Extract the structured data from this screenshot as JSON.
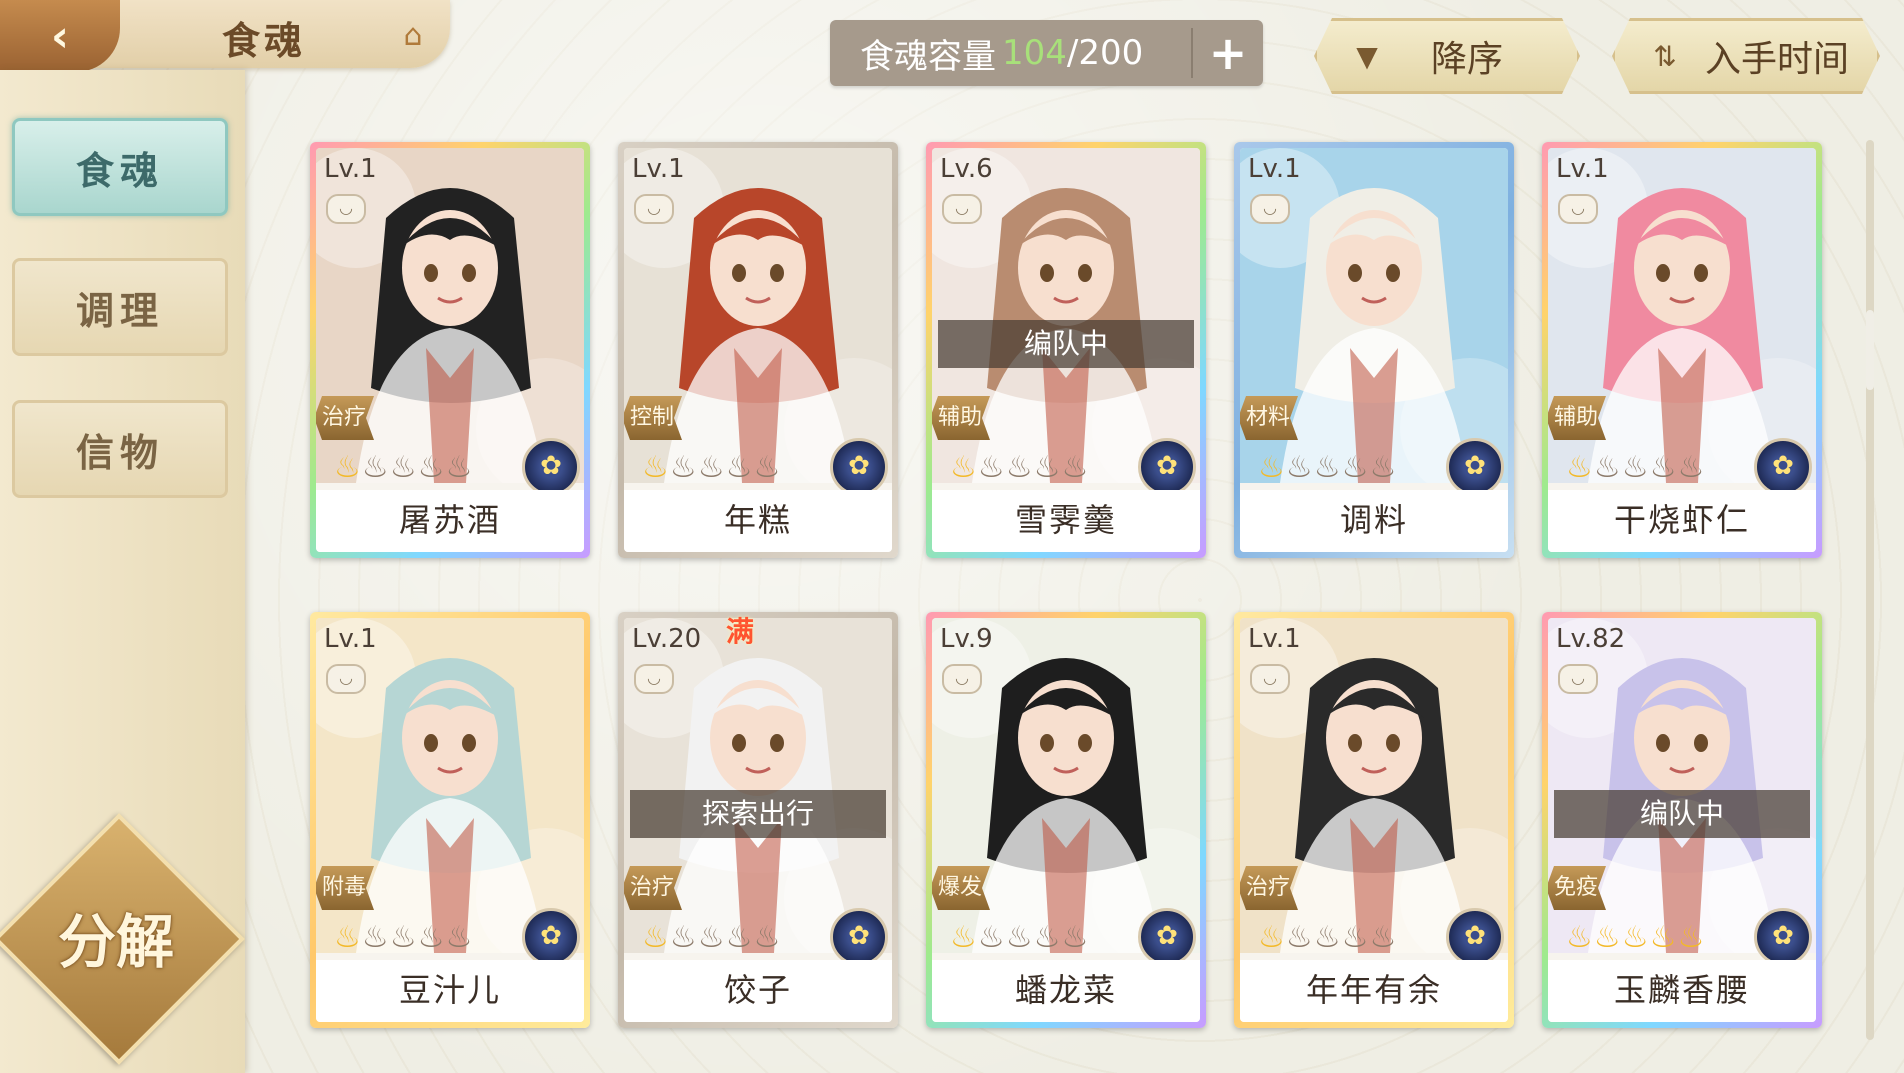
{
  "header": {
    "back_icon": "chevron-left-icon",
    "title": "食魂",
    "house_icon": "house-icon",
    "capacity": {
      "label": "食魂容量",
      "current": "104",
      "max": "/200",
      "add": "+"
    },
    "sort_order": {
      "icon": "triangle-down-icon",
      "label": "降序"
    },
    "sort_by": {
      "icon": "swap-icon",
      "label": "入手时间"
    }
  },
  "sidebar": {
    "items": [
      {
        "label": "食魂",
        "active": true
      },
      {
        "label": "调理",
        "active": false
      },
      {
        "label": "信物",
        "active": false
      }
    ],
    "decompose_label": "分解"
  },
  "cards": [
    {
      "level": "Lv.1",
      "role": "治疗",
      "name": "屠苏酒",
      "status": "",
      "stars": 1,
      "full": "",
      "frame": "rainbow",
      "badge_icon": "flower-badge-icon",
      "hair": "#222",
      "bg": "#e8d6c6"
    },
    {
      "level": "Lv.1",
      "role": "控制",
      "name": "年糕",
      "status": "",
      "stars": 1,
      "full": "",
      "frame": "grey",
      "badge_icon": "flower-badge-icon",
      "hair": "#b8462a",
      "bg": "#e7e1d6"
    },
    {
      "level": "Lv.6",
      "role": "辅助",
      "name": "雪霁羹",
      "status": "编队中",
      "stars": 1,
      "full": "",
      "frame": "rainbow",
      "badge_icon": "flower-badge-icon",
      "hair": "#b98c70",
      "bg": "#f0e6e0"
    },
    {
      "level": "Lv.1",
      "role": "材料",
      "name": "调料",
      "status": "",
      "stars": 1,
      "full": "",
      "frame": "blue",
      "badge_icon": "flower-badge-icon",
      "hair": "#f0eee6",
      "bg": "#a8d4ea"
    },
    {
      "level": "Lv.1",
      "role": "辅助",
      "name": "干烧虾仁",
      "status": "",
      "stars": 1,
      "full": "",
      "frame": "rainbow",
      "badge_icon": "flame-badge-icon",
      "hair": "#f08aa0",
      "bg": "#e0e6ee"
    },
    {
      "level": "Lv.1",
      "role": "附毒",
      "name": "豆汁儿",
      "status": "",
      "stars": 1,
      "full": "",
      "frame": "gold",
      "badge_icon": "flower-badge-icon",
      "hair": "#b6d6d4",
      "bg": "#f4e6c8"
    },
    {
      "level": "Lv.20",
      "role": "治疗",
      "name": "饺子",
      "status": "探索出行",
      "stars": 1,
      "full": "满",
      "frame": "grey",
      "badge_icon": "flower-badge-icon",
      "hair": "#f2f2f2",
      "bg": "#e8e2d8"
    },
    {
      "level": "Lv.9",
      "role": "爆发",
      "name": "蟠龙菜",
      "status": "",
      "stars": 1,
      "full": "",
      "frame": "rainbow",
      "badge_icon": "flower-badge-icon",
      "hair": "#1e1e1e",
      "bg": "#eef0e6"
    },
    {
      "level": "Lv.1",
      "role": "治疗",
      "name": "年年有余",
      "status": "",
      "stars": 1,
      "full": "",
      "frame": "gold",
      "badge_icon": "flame-badge-icon",
      "hair": "#2a2a2a",
      "bg": "#f0e2c8"
    },
    {
      "level": "Lv.82",
      "role": "免疫",
      "name": "玉麟香腰",
      "status": "编队中",
      "stars": 5,
      "full": "",
      "frame": "rainbow",
      "badge_icon": "flower-badge-icon",
      "hair": "#c8c2ea",
      "bg": "#eee8f4"
    }
  ],
  "colors": {
    "capacity_current": "#a8e07a",
    "star_on": "#f3b928",
    "star_off": "#8c7a6a"
  }
}
